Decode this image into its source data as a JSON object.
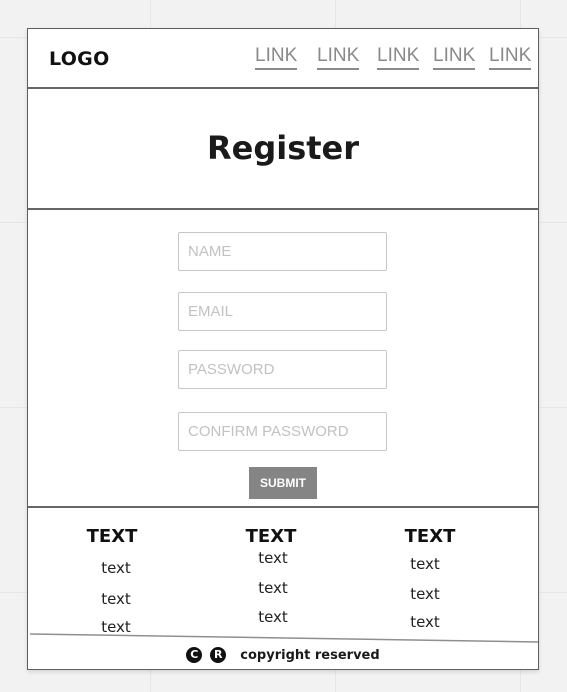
{
  "header": {
    "logo": "LOGO",
    "links": [
      "LINK",
      "LINK",
      "LINK",
      "LINK",
      "LINK"
    ]
  },
  "page": {
    "title": "Register"
  },
  "form": {
    "name_placeholder": "NAME",
    "email_placeholder": "EMAIL",
    "password_placeholder": "PASSWORD",
    "confirm_placeholder": "CONFIRM PASSWORD",
    "submit_label": "SUBMIT"
  },
  "footer": {
    "columns": [
      {
        "heading": "TEXT",
        "items": [
          "text",
          "text",
          "text"
        ]
      },
      {
        "heading": "TEXT",
        "items": [
          "text",
          "text",
          "text"
        ]
      },
      {
        "heading": "TEXT",
        "items": [
          "text",
          "text",
          "text"
        ]
      }
    ],
    "copyright_symbol": "C",
    "registered_symbol": "R",
    "copyright_text": "copyright reserved"
  },
  "colors": {
    "border": "#666666",
    "link": "#8a8a8a",
    "button": "#858585",
    "placeholder": "#c2c2c2"
  }
}
